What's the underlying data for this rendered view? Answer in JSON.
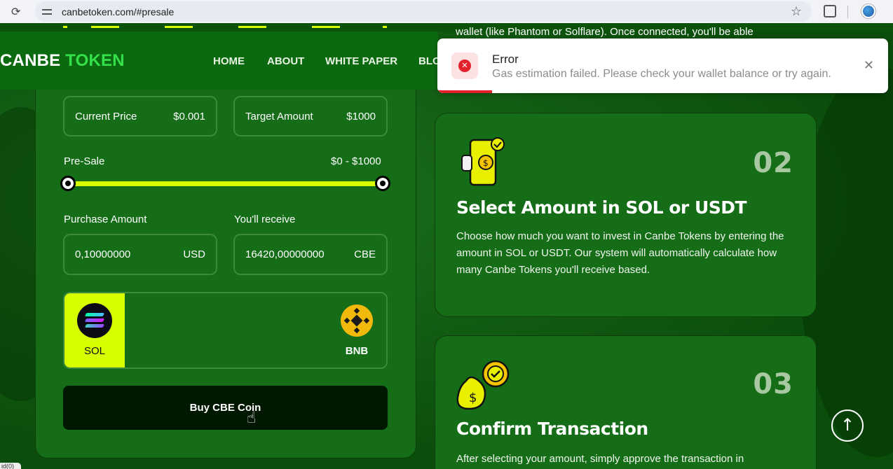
{
  "browser": {
    "url": "canbetoken.com/#presale"
  },
  "header": {
    "logo_white": "CANBE",
    "logo_green": "TOKEN",
    "nav": [
      "HOME",
      "ABOUT",
      "WHITE PAPER",
      "BLO"
    ]
  },
  "presale": {
    "current_price_label": "Current Price",
    "current_price_value": "$0.001",
    "target_label": "Target Amount",
    "target_value": "$1000",
    "presale_label": "Pre-Sale",
    "presale_range": "$0 - $1000",
    "purchase_label": "Purchase Amount",
    "receive_label": "You'll receive",
    "purchase_value": "0,10000000",
    "purchase_unit": "USD",
    "receive_value": "16420,00000000",
    "receive_unit": "CBE",
    "chains": [
      {
        "label": "SOL",
        "selected": true
      },
      {
        "label": "BNB",
        "selected": false
      }
    ],
    "buy_label": "Buy CBE Coin"
  },
  "steps": [
    {
      "num": "02",
      "title": "Select Amount in SOL or USDT",
      "desc": "Choose how much you want to invest in Canbe Tokens by entering the amount in SOL or USDT. Our system will automatically calculate how many Canbe Tokens you'll receive based."
    },
    {
      "num": "03",
      "title": "Confirm Transaction",
      "desc": "After selecting your amount, simply approve the transaction in"
    }
  ],
  "partial_top_text": "wallet (like Phantom or Solflare). Once connected, you'll be able",
  "toast": {
    "title": "Error",
    "message": "Gas estimation failed. Please check your wallet balance or try again."
  },
  "status_chip": "id(0)",
  "colors": {
    "accent": "#d8ff00",
    "brand_green": "#34e14a",
    "error": "#e3222b"
  }
}
